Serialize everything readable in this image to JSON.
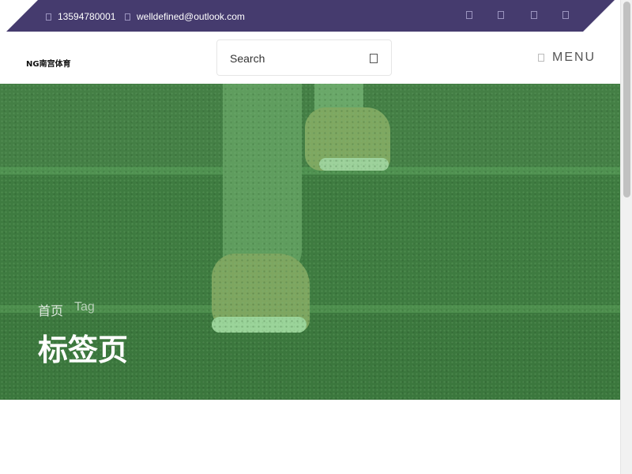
{
  "topbar": {
    "phone": "13594780001",
    "email": "welldefined@outlook.com",
    "social_icons": [
      "social-icon-1",
      "social-icon-2",
      "social-icon-3",
      "social-icon-4"
    ]
  },
  "header": {
    "logo": "NG南宫体育",
    "search_placeholder": "Search",
    "search_icon": "search-icon",
    "menu_label": "MENU",
    "menu_icon": "menu-icon"
  },
  "hero": {
    "breadcrumb": [
      "首页",
      "Tag"
    ],
    "title": "标签页"
  },
  "colors": {
    "topbar_bg": "#453b6e",
    "hero_overlay": "#3f7d3f"
  }
}
